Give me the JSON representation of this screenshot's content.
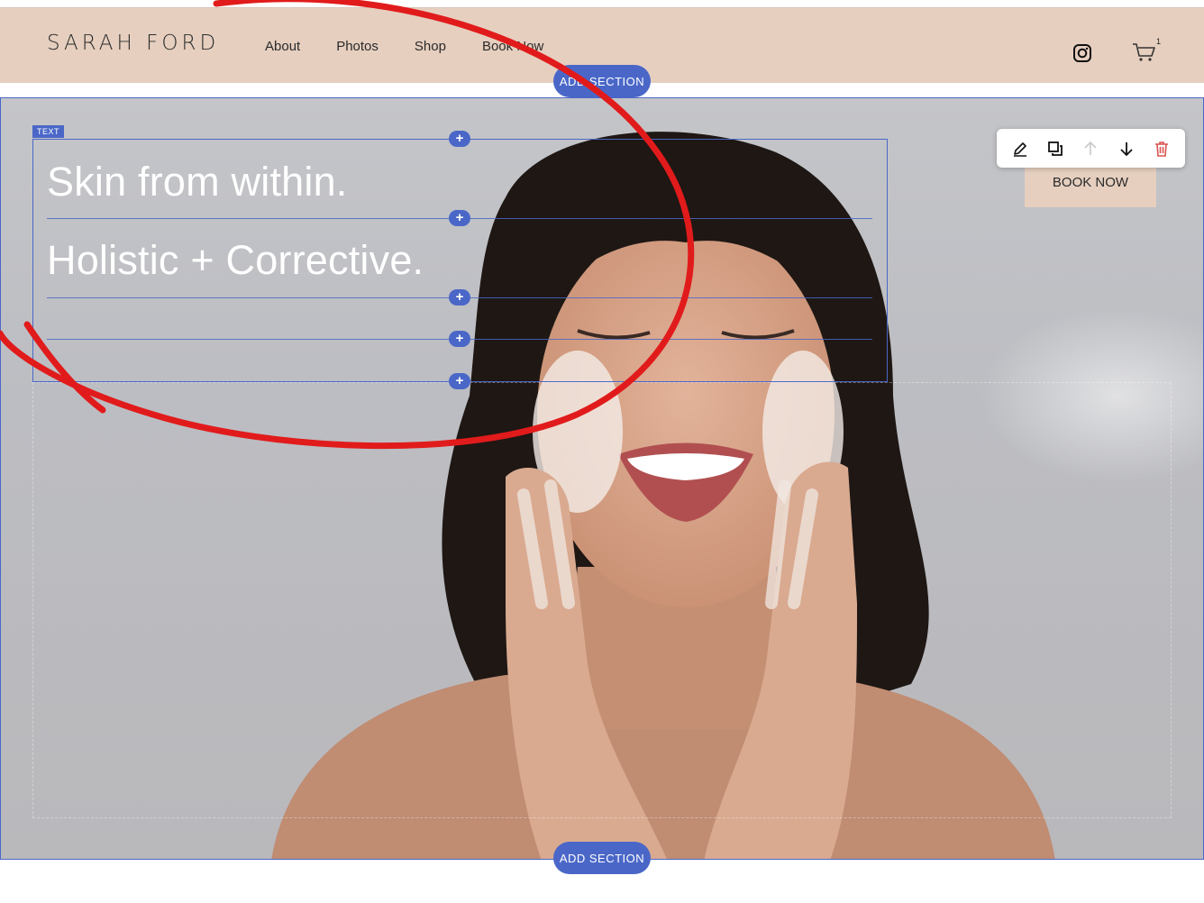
{
  "header": {
    "logo": "SARAH FORD",
    "nav": [
      "About",
      "Photos",
      "Shop",
      "Book Now"
    ],
    "cart_count": "1"
  },
  "editor": {
    "add_section_label": "ADD SECTION",
    "text_block_label": "TEXT",
    "toolbar_icons": [
      "pencil-icon",
      "duplicate-icon",
      "arrow-up-icon",
      "arrow-down-icon",
      "trash-icon"
    ]
  },
  "hero": {
    "heading_1": "Skin from within.",
    "heading_2": "Holistic + Corrective.",
    "book_button": "BOOK NOW"
  },
  "colors": {
    "header_bg": "#e6cfbf",
    "editor_accent": "#4a67c8",
    "annotation_red": "#e11b1b"
  }
}
